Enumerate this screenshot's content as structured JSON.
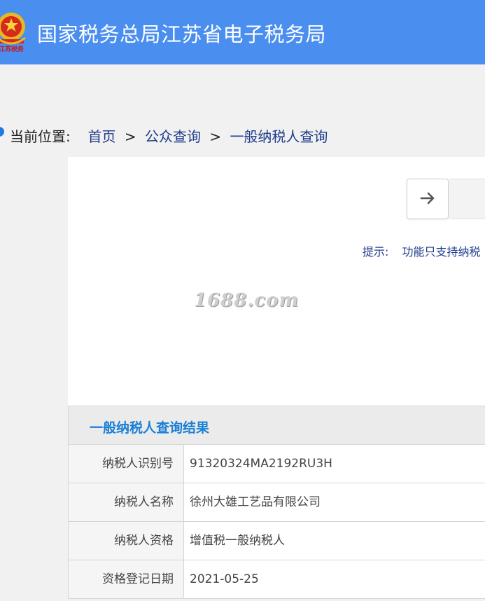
{
  "header": {
    "title": "国家税务总局江苏省电子税务局",
    "emblem_text": "江苏税务",
    "color": "#4a8ff0"
  },
  "breadcrumb": {
    "label": "当前位置:",
    "items": [
      "首页",
      "公众查询",
      "一般纳税人查询"
    ],
    "separator": ">"
  },
  "search": {
    "button_icon": "arrow-right-icon",
    "tip_label": "提示:",
    "tip_text": "功能只支持纳税"
  },
  "watermark": "1688.com",
  "result": {
    "title": "一般纳税人查询结果",
    "rows": [
      {
        "label": "纳税人识别号",
        "value": "91320324MA2192RU3H"
      },
      {
        "label": "纳税人名称",
        "value": "徐州大雄工艺品有限公司"
      },
      {
        "label": "纳税人资格",
        "value": "增值税一般纳税人"
      },
      {
        "label": "资格登记日期",
        "value": "2021-05-25"
      }
    ]
  }
}
